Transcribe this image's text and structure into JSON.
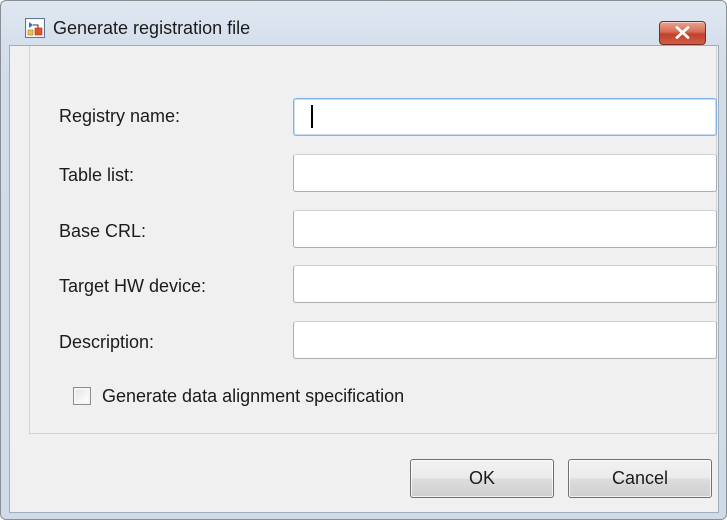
{
  "window": {
    "title": "Generate registration file",
    "icon": "simulink-model-icon"
  },
  "form": {
    "fields": [
      {
        "label": "Registry name:",
        "value": "",
        "focused": true
      },
      {
        "label": "Table list:",
        "value": ""
      },
      {
        "label": "Base CRL:",
        "value": ""
      },
      {
        "label": "Target HW device:",
        "value": ""
      },
      {
        "label": "Description:",
        "value": ""
      }
    ],
    "checkbox": {
      "label": "Generate data alignment specification",
      "checked": false
    }
  },
  "buttons": {
    "ok": "OK",
    "cancel": "Cancel"
  },
  "colors": {
    "title_bar": "#d6e0ec",
    "close_button": "#c94a35",
    "client_background": "#f0f0f0",
    "focus_border": "#7eb4ea"
  }
}
